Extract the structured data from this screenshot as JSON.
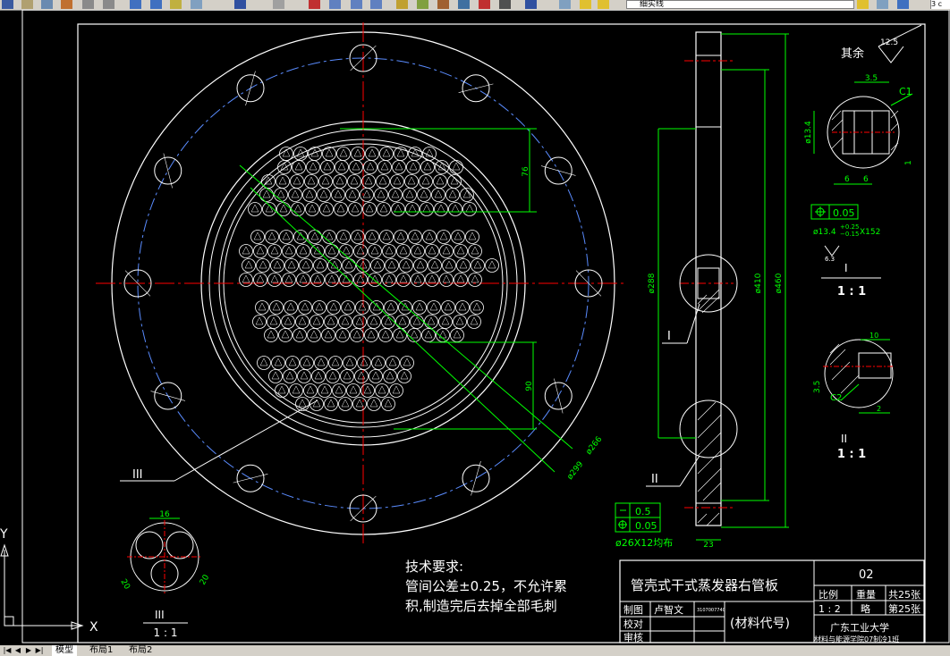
{
  "toolbar": {
    "layer_name": "细实线",
    "right_field": "3 c"
  },
  "drawing": {
    "dims": {
      "d76": "76",
      "d90": "90",
      "d266": "ø266",
      "d299": "ø299",
      "d288": "ø288",
      "d410": "ø410",
      "d460": "ø460",
      "d23": "23",
      "d16": "16",
      "d20a": "20",
      "d20b": "20",
      "d35": "3.5",
      "c1": "C1",
      "d134": "ø13.4",
      "d6a": "6",
      "d6b": "6",
      "d1": "1",
      "d10": "10",
      "d35b": "3.5",
      "c2": "C2",
      "d2": "2"
    },
    "tol1": "0.05",
    "tol1_note": "ø13.4",
    "tol1_dev_up": "+0.25",
    "tol1_dev_down": "−0.15",
    "tol1_suffix": "X152",
    "tol2_a": "0.5",
    "tol2_b": "0.05",
    "hole_note": "ø26X12均布",
    "roughness_label": "其余",
    "roughness_value": "12.5",
    "leader_3": "III",
    "leader_1": "I",
    "leader_2": "II",
    "detail_1": "I",
    "detail_2": "II",
    "detail_3": "III",
    "scale": "1 : 1",
    "small_roughness": "6.3",
    "axis_y": "Y",
    "axis_x": "X"
  },
  "tech": {
    "title": "技术要求:",
    "line1": "管间公差±0.25，不允许累",
    "line2": "积,制造完后去掉全部毛刺"
  },
  "titleblock": {
    "name": "管壳式干式蒸发器右管板",
    "code": "02",
    "scale_label": "比例",
    "weight_label": "重量",
    "sheets": "共25张",
    "scale_value": "1 : 2",
    "weight_value": "略",
    "sheet_no": "第25张",
    "drawn_label": "制图",
    "drawn_name": "卢智文",
    "drawn_id": "3107007740",
    "check_label": "校对",
    "review_label": "审核",
    "material": "(材料代号)",
    "school": "广东工业大学",
    "class": "材料与能源学院07制冷1班"
  },
  "tabs": [
    "模型",
    "布局1",
    "布局2"
  ],
  "colors": {
    "white": "#ffffff",
    "green": "#00ff00",
    "red": "#ff0000",
    "blue": "#5a8cff"
  }
}
